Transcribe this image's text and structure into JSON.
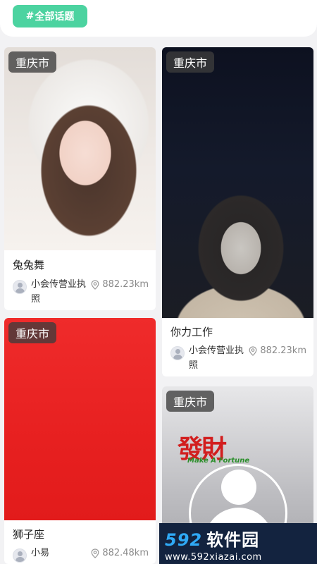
{
  "header": {
    "topic_chip": {
      "hash": "#",
      "label": "全部话题"
    }
  },
  "cards": [
    {
      "city": "重庆市",
      "title": "兔兔舞",
      "author": "小会传营业执照",
      "distance": "882.23km",
      "photo": "portrait-girl-white-fur-hood"
    },
    {
      "city": "重庆市",
      "title": "你力工作",
      "author": "小会传营业执照",
      "distance": "882.23km",
      "photo": "portrait-girl-car-night"
    },
    {
      "city": "重庆市",
      "title": "狮子座",
      "author": "小易",
      "distance": "882.48km",
      "photo": "solid-red"
    },
    {
      "city": "重庆市",
      "photo": "fortune-default-avatar",
      "fortune_text": "發財",
      "fortune_sub": "Make A Fortune"
    }
  ],
  "watermark": {
    "number": "592",
    "name": "软件园",
    "url": "www.592xiazai.com"
  },
  "icons": {
    "distance": "location-pin-icon",
    "avatar": "user-avatar-icon"
  },
  "colors": {
    "accent": "#4cd3a0",
    "badge_bg": "#3c3c3c",
    "watermark_bg": "#13233f",
    "watermark_num": "#2fa9f5"
  }
}
